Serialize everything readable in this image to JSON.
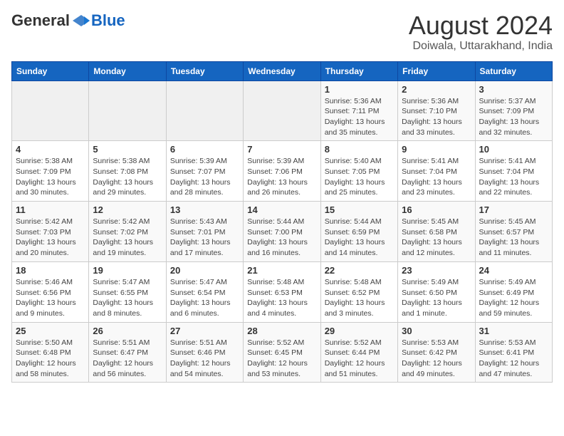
{
  "logo": {
    "general": "General",
    "blue": "Blue"
  },
  "header": {
    "title": "August 2024",
    "subtitle": "Doiwala, Uttarakhand, India"
  },
  "weekdays": [
    "Sunday",
    "Monday",
    "Tuesday",
    "Wednesday",
    "Thursday",
    "Friday",
    "Saturday"
  ],
  "weeks": [
    [
      {
        "day": "",
        "info": ""
      },
      {
        "day": "",
        "info": ""
      },
      {
        "day": "",
        "info": ""
      },
      {
        "day": "",
        "info": ""
      },
      {
        "day": "1",
        "info": "Sunrise: 5:36 AM\nSunset: 7:11 PM\nDaylight: 13 hours\nand 35 minutes."
      },
      {
        "day": "2",
        "info": "Sunrise: 5:36 AM\nSunset: 7:10 PM\nDaylight: 13 hours\nand 33 minutes."
      },
      {
        "day": "3",
        "info": "Sunrise: 5:37 AM\nSunset: 7:09 PM\nDaylight: 13 hours\nand 32 minutes."
      }
    ],
    [
      {
        "day": "4",
        "info": "Sunrise: 5:38 AM\nSunset: 7:09 PM\nDaylight: 13 hours\nand 30 minutes."
      },
      {
        "day": "5",
        "info": "Sunrise: 5:38 AM\nSunset: 7:08 PM\nDaylight: 13 hours\nand 29 minutes."
      },
      {
        "day": "6",
        "info": "Sunrise: 5:39 AM\nSunset: 7:07 PM\nDaylight: 13 hours\nand 28 minutes."
      },
      {
        "day": "7",
        "info": "Sunrise: 5:39 AM\nSunset: 7:06 PM\nDaylight: 13 hours\nand 26 minutes."
      },
      {
        "day": "8",
        "info": "Sunrise: 5:40 AM\nSunset: 7:05 PM\nDaylight: 13 hours\nand 25 minutes."
      },
      {
        "day": "9",
        "info": "Sunrise: 5:41 AM\nSunset: 7:04 PM\nDaylight: 13 hours\nand 23 minutes."
      },
      {
        "day": "10",
        "info": "Sunrise: 5:41 AM\nSunset: 7:04 PM\nDaylight: 13 hours\nand 22 minutes."
      }
    ],
    [
      {
        "day": "11",
        "info": "Sunrise: 5:42 AM\nSunset: 7:03 PM\nDaylight: 13 hours\nand 20 minutes."
      },
      {
        "day": "12",
        "info": "Sunrise: 5:42 AM\nSunset: 7:02 PM\nDaylight: 13 hours\nand 19 minutes."
      },
      {
        "day": "13",
        "info": "Sunrise: 5:43 AM\nSunset: 7:01 PM\nDaylight: 13 hours\nand 17 minutes."
      },
      {
        "day": "14",
        "info": "Sunrise: 5:44 AM\nSunset: 7:00 PM\nDaylight: 13 hours\nand 16 minutes."
      },
      {
        "day": "15",
        "info": "Sunrise: 5:44 AM\nSunset: 6:59 PM\nDaylight: 13 hours\nand 14 minutes."
      },
      {
        "day": "16",
        "info": "Sunrise: 5:45 AM\nSunset: 6:58 PM\nDaylight: 13 hours\nand 12 minutes."
      },
      {
        "day": "17",
        "info": "Sunrise: 5:45 AM\nSunset: 6:57 PM\nDaylight: 13 hours\nand 11 minutes."
      }
    ],
    [
      {
        "day": "18",
        "info": "Sunrise: 5:46 AM\nSunset: 6:56 PM\nDaylight: 13 hours\nand 9 minutes."
      },
      {
        "day": "19",
        "info": "Sunrise: 5:47 AM\nSunset: 6:55 PM\nDaylight: 13 hours\nand 8 minutes."
      },
      {
        "day": "20",
        "info": "Sunrise: 5:47 AM\nSunset: 6:54 PM\nDaylight: 13 hours\nand 6 minutes."
      },
      {
        "day": "21",
        "info": "Sunrise: 5:48 AM\nSunset: 6:53 PM\nDaylight: 13 hours\nand 4 minutes."
      },
      {
        "day": "22",
        "info": "Sunrise: 5:48 AM\nSunset: 6:52 PM\nDaylight: 13 hours\nand 3 minutes."
      },
      {
        "day": "23",
        "info": "Sunrise: 5:49 AM\nSunset: 6:50 PM\nDaylight: 13 hours\nand 1 minute."
      },
      {
        "day": "24",
        "info": "Sunrise: 5:49 AM\nSunset: 6:49 PM\nDaylight: 12 hours\nand 59 minutes."
      }
    ],
    [
      {
        "day": "25",
        "info": "Sunrise: 5:50 AM\nSunset: 6:48 PM\nDaylight: 12 hours\nand 58 minutes."
      },
      {
        "day": "26",
        "info": "Sunrise: 5:51 AM\nSunset: 6:47 PM\nDaylight: 12 hours\nand 56 minutes."
      },
      {
        "day": "27",
        "info": "Sunrise: 5:51 AM\nSunset: 6:46 PM\nDaylight: 12 hours\nand 54 minutes."
      },
      {
        "day": "28",
        "info": "Sunrise: 5:52 AM\nSunset: 6:45 PM\nDaylight: 12 hours\nand 53 minutes."
      },
      {
        "day": "29",
        "info": "Sunrise: 5:52 AM\nSunset: 6:44 PM\nDaylight: 12 hours\nand 51 minutes."
      },
      {
        "day": "30",
        "info": "Sunrise: 5:53 AM\nSunset: 6:42 PM\nDaylight: 12 hours\nand 49 minutes."
      },
      {
        "day": "31",
        "info": "Sunrise: 5:53 AM\nSunset: 6:41 PM\nDaylight: 12 hours\nand 47 minutes."
      }
    ]
  ]
}
